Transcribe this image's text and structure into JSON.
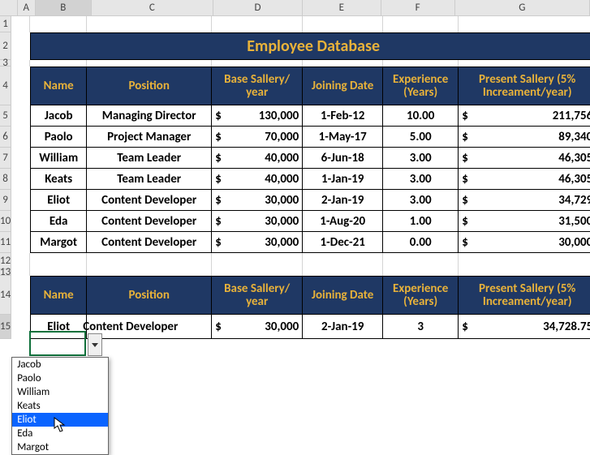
{
  "columns": [
    "A",
    "B",
    "C",
    "D",
    "E",
    "F",
    "G"
  ],
  "rows_left": [
    "1",
    "2",
    "3",
    "4",
    "5",
    "6",
    "7",
    "8",
    "9",
    "10",
    "11",
    "12",
    "13",
    "14",
    "15"
  ],
  "title": "Employee Database",
  "headers": {
    "name": "Name",
    "position": "Position",
    "base": "Base Sallery/ year",
    "joining": "Joining Date",
    "exp": "Experience (Years)",
    "present": "Present Sallery\n(5% Increament/year)"
  },
  "chart_data": {
    "type": "table",
    "columns": [
      "Name",
      "Position",
      "Base Sallery/year",
      "Joining Date",
      "Experience (Years)",
      "Present Sallery (5% Increament/year)"
    ],
    "rows": [
      {
        "name": "Jacob",
        "position": "Managing Director",
        "base": 130000,
        "base_disp": "130,000",
        "joining": "1-Feb-12",
        "exp": "10.00",
        "present": 211756,
        "present_disp": "211,756"
      },
      {
        "name": "Paolo",
        "position": "Project Manager",
        "base": 70000,
        "base_disp": "70,000",
        "joining": "1-May-17",
        "exp": "5.00",
        "present": 89340,
        "present_disp": "89,340"
      },
      {
        "name": "William",
        "position": "Team Leader",
        "base": 40000,
        "base_disp": "40,000",
        "joining": "6-Jun-18",
        "exp": "3.00",
        "present": 46305,
        "present_disp": "46,305"
      },
      {
        "name": "Keats",
        "position": "Team Leader",
        "base": 40000,
        "base_disp": "40,000",
        "joining": "1-Jan-19",
        "exp": "3.00",
        "present": 46305,
        "present_disp": "46,305"
      },
      {
        "name": "Eliot",
        "position": "Content Developer",
        "base": 30000,
        "base_disp": "30,000",
        "joining": "2-Jan-19",
        "exp": "3.00",
        "present": 34729,
        "present_disp": "34,729"
      },
      {
        "name": "Eda",
        "position": "Content Developer",
        "base": 30000,
        "base_disp": "30,000",
        "joining": "1-Aug-20",
        "exp": "1.00",
        "present": 31500,
        "present_disp": "31,500"
      },
      {
        "name": "Margot",
        "position": "Content Developer",
        "base": 30000,
        "base_disp": "30,000",
        "joining": "1-Dec-21",
        "exp": "0.00",
        "present": 30000,
        "present_disp": "30,000"
      }
    ]
  },
  "lookup_row": {
    "name": "Eliot",
    "position": "Content Developer",
    "base_disp": "30,000",
    "joining": "2-Jan-19",
    "exp": "3",
    "present_disp": "34,728.75"
  },
  "dollar": "$",
  "dropdown": {
    "options": [
      "Jacob",
      "Paolo",
      "William",
      "Keats",
      "Eliot",
      "Eda",
      "Margot"
    ],
    "selected": "Eliot"
  },
  "selected_col": "B"
}
